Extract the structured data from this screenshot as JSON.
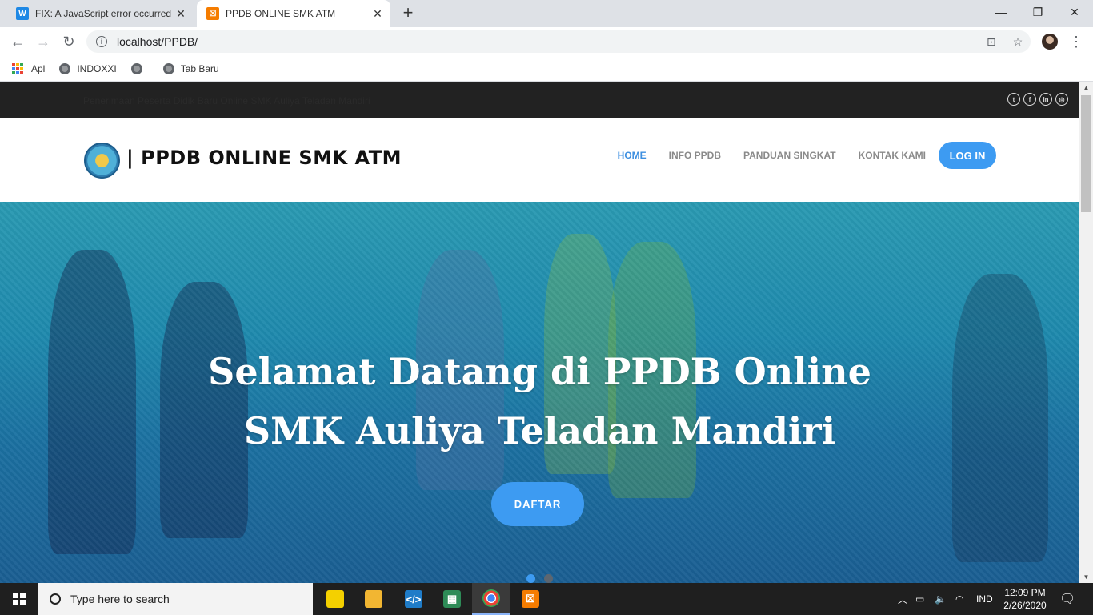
{
  "browser": {
    "tabs": [
      {
        "title": "FIX: A JavaScript error occurred in",
        "favicon": "W",
        "favicon_color": "#1e88e5"
      },
      {
        "title": "PPDB ONLINE SMK ATM",
        "favicon": "☒",
        "favicon_color": "#f57c00"
      }
    ],
    "url": "localhost/PPDB/",
    "bookmarks": [
      {
        "label": "Apl",
        "icon": "apps-grid-icon"
      },
      {
        "label": "INDOXXI",
        "icon": "globe-icon"
      },
      {
        "label": "",
        "icon": "globe-icon"
      },
      {
        "label": "Tab Baru",
        "icon": "globe-icon"
      }
    ]
  },
  "page": {
    "topbar_text": "Penerimaan Peserta Didik Baru Online SMK Auliya Teladan Mandiri",
    "social_icons": [
      "twitter-icon",
      "facebook-icon",
      "linkedin-icon",
      "instagram-icon"
    ],
    "brand": "| PPDB ONLINE SMK ATM",
    "nav": [
      {
        "label": "HOME",
        "active": true
      },
      {
        "label": "INFO PPDB",
        "active": false
      },
      {
        "label": "PANDUAN SINGKAT",
        "active": false
      },
      {
        "label": "KONTAK KAMI",
        "active": false
      }
    ],
    "login_label": "LOG IN",
    "hero": {
      "title_line1": "Selamat Datang di PPDB Online",
      "title_line2": "SMK Auliya Teladan Mandiri",
      "button": "DAFTAR",
      "slides": 2,
      "active_slide": 1
    },
    "accent_color": "#3d9bf2"
  },
  "taskbar": {
    "search_placeholder": "Type here to search",
    "apps": [
      "sticky-notes-icon",
      "file-explorer-icon",
      "vscode-icon",
      "spreadsheet-icon",
      "chrome-icon",
      "xampp-icon"
    ],
    "language": "IND",
    "time": "12:09 PM",
    "date": "2/26/2020"
  }
}
